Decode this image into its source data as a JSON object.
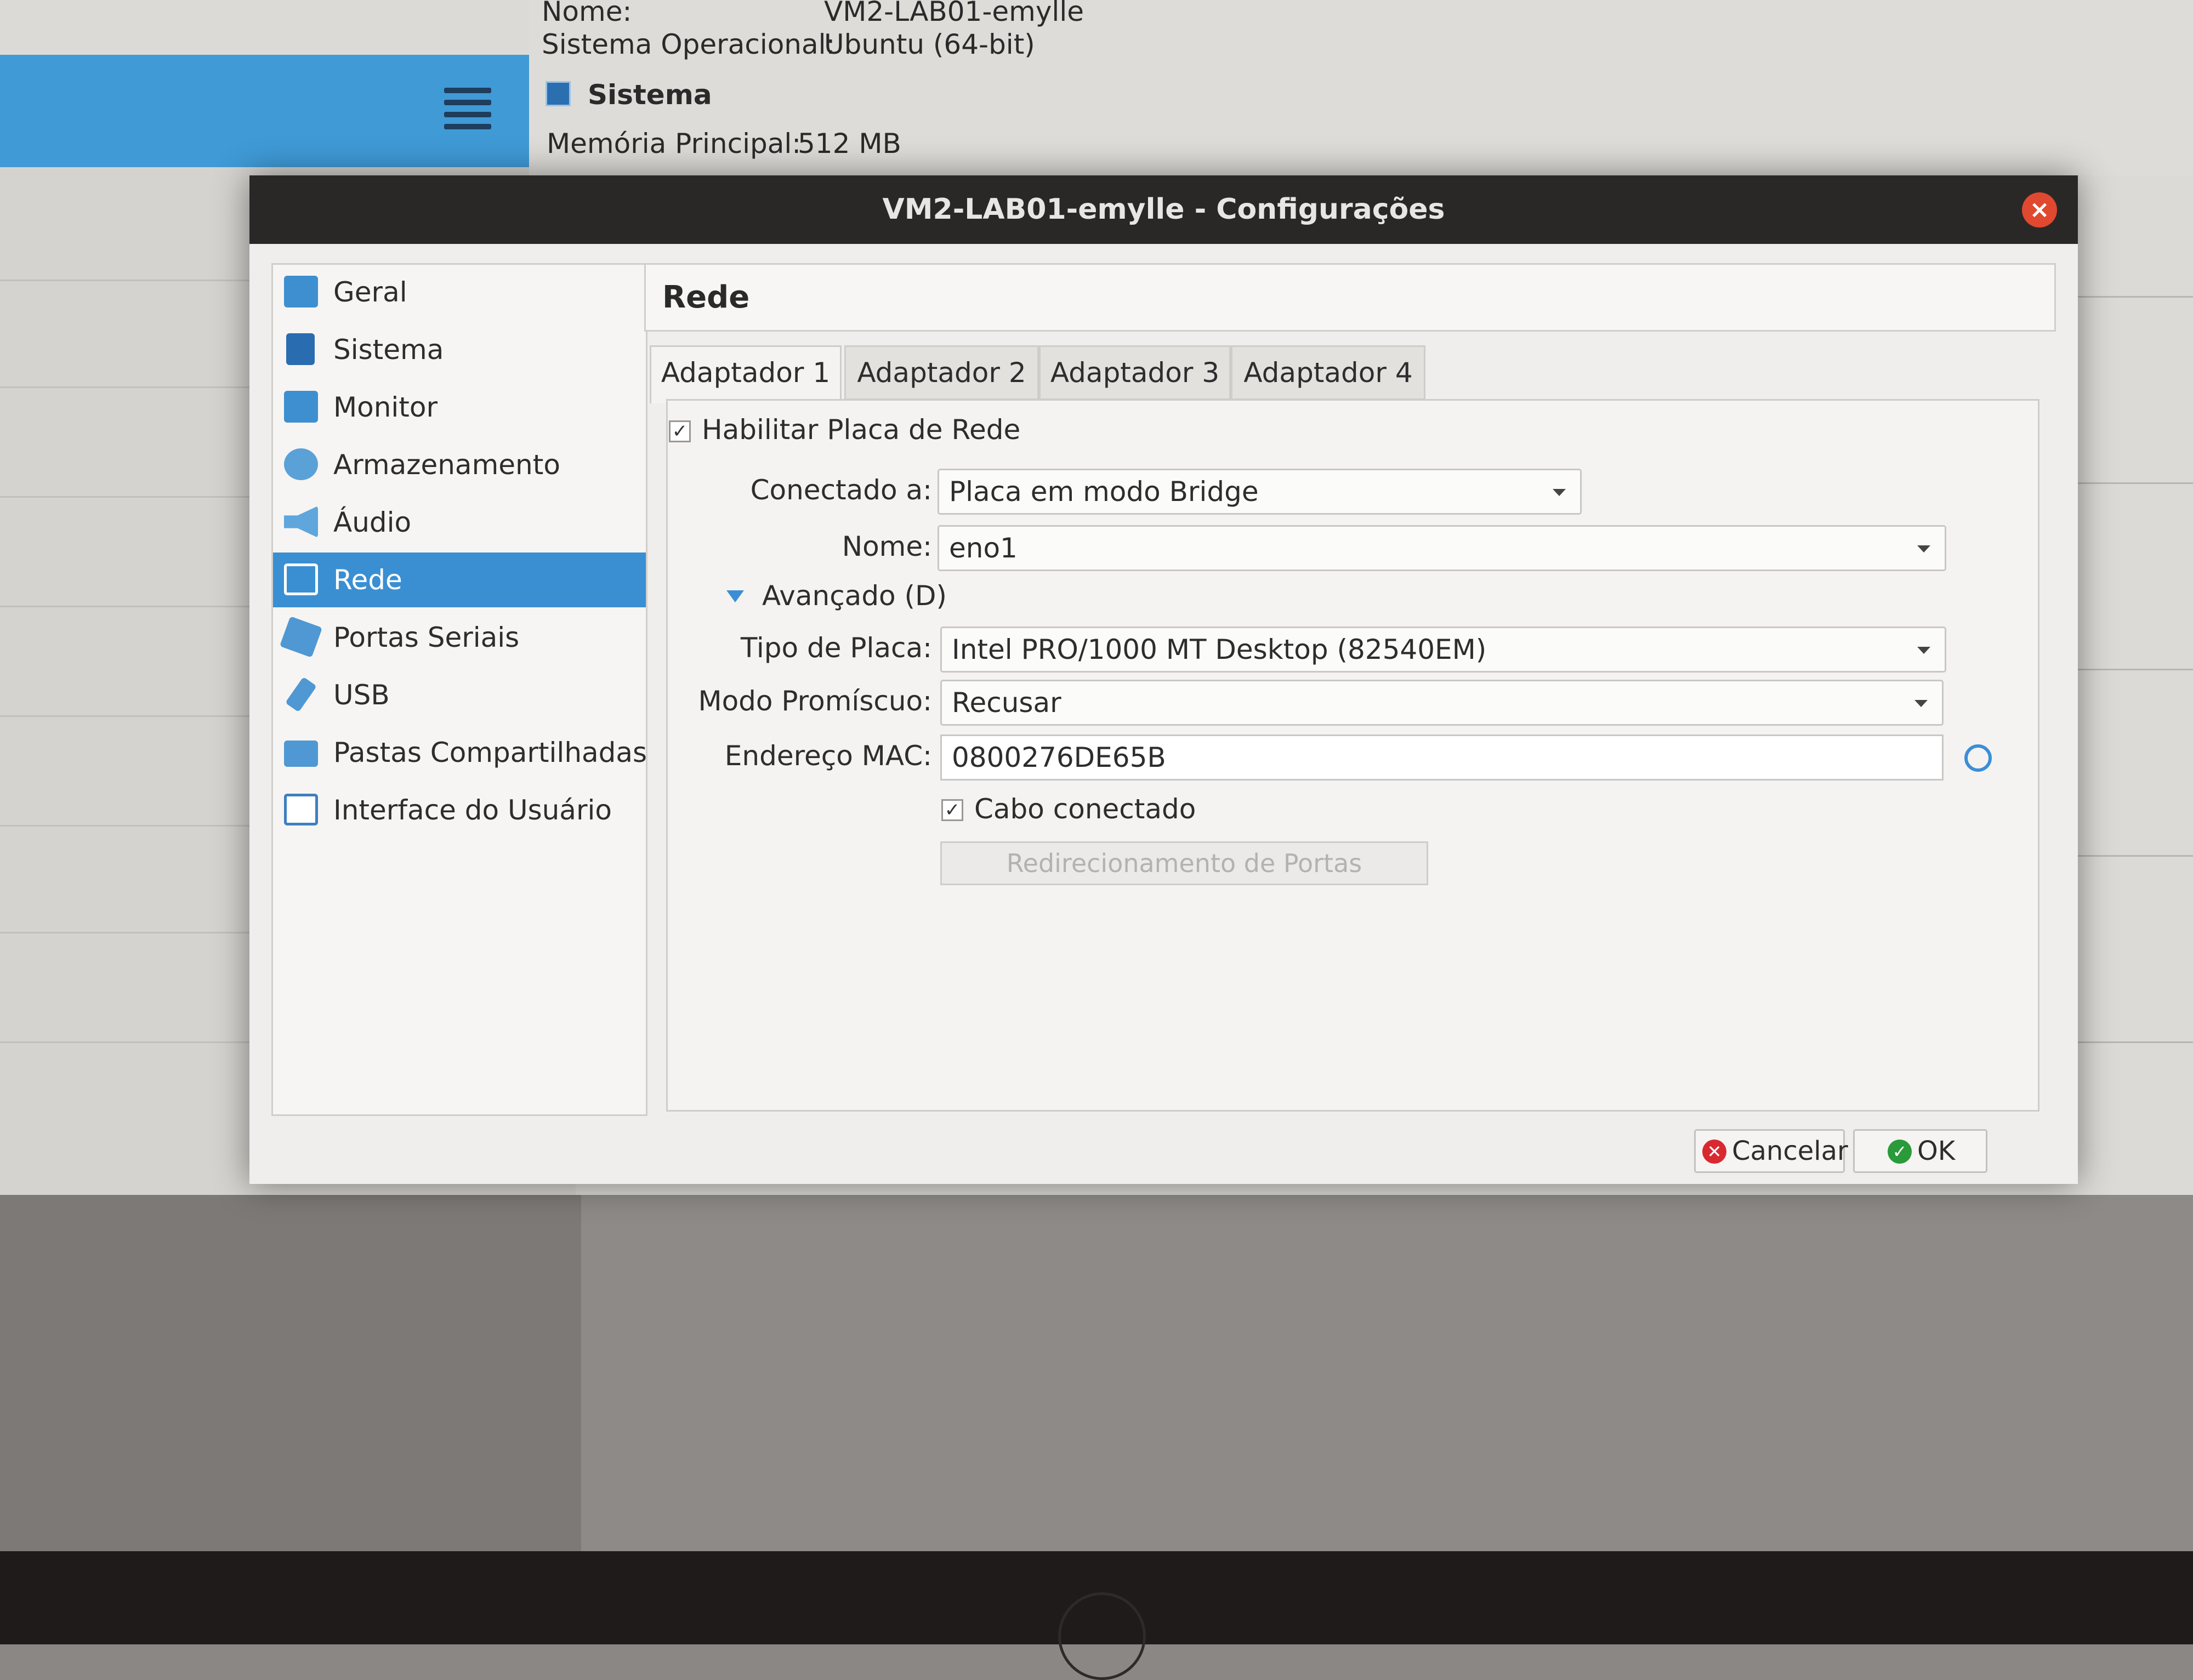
{
  "background": {
    "name_label": "Nome:",
    "name_value": "VM2-LAB01-emylle",
    "os_label": "Sistema Operacional:",
    "os_value": "Ubuntu (64-bit)",
    "section_title": "Sistema",
    "memory_label": "Memória Principal:",
    "memory_value": "512 MB"
  },
  "dialog": {
    "title": "VM2-LAB01-emylle - Configurações",
    "close_symbol": "×"
  },
  "nav": {
    "items": [
      {
        "label": "Geral",
        "icon": "monitor-icon",
        "color": "#3e8fd0"
      },
      {
        "label": "Sistema",
        "icon": "chip-icon",
        "color": "#2a6cb0"
      },
      {
        "label": "Monitor",
        "icon": "display-icon",
        "color": "#3e8fd0"
      },
      {
        "label": "Armazenamento",
        "icon": "disk-icon",
        "color": "#5aa1d8"
      },
      {
        "label": "Áudio",
        "icon": "speaker-icon",
        "color": "#5ea6dc"
      },
      {
        "label": "Rede",
        "icon": "network-icon",
        "color": "#ffffff"
      },
      {
        "label": "Portas Seriais",
        "icon": "serial-port-icon",
        "color": "#4f98d3"
      },
      {
        "label": "USB",
        "icon": "usb-icon",
        "color": "#4f98d3"
      },
      {
        "label": "Pastas Compartilhadas",
        "icon": "folder-icon",
        "color": "#4f98d3"
      },
      {
        "label": "Interface do Usuário",
        "icon": "window-icon",
        "color": "#3e7fc0"
      }
    ],
    "selected": "Rede"
  },
  "panel": {
    "title": "Rede",
    "tabs": [
      "Adaptador 1",
      "Adaptador 2",
      "Adaptador 3",
      "Adaptador 4"
    ],
    "active_tab": "Adaptador 1",
    "enable_adapter_label": "Habilitar Placa de Rede",
    "enable_adapter_checked": true,
    "attached_label": "Conectado a:",
    "attached_value": "Placa em modo Bridge",
    "name_label": "Nome:",
    "name_value": "eno1",
    "advanced_label": "Avançado (D)",
    "adapter_type_label": "Tipo de Placa:",
    "adapter_type_value": "Intel PRO/1000 MT Desktop (82540EM)",
    "promisc_label": "Modo Promíscuo:",
    "promisc_value": "Recusar",
    "mac_label": "Endereço MAC:",
    "mac_value": "0800276DE65B",
    "cable_label": "Cabo conectado",
    "cable_checked": true,
    "port_forwarding_label": "Redirecionamento de Portas"
  },
  "buttons": {
    "cancel": "Cancelar",
    "ok": "OK"
  },
  "colors": {
    "selection": "#3a8fd3",
    "cancel_icon": "#d9282f",
    "ok_icon": "#2a9a3a"
  }
}
